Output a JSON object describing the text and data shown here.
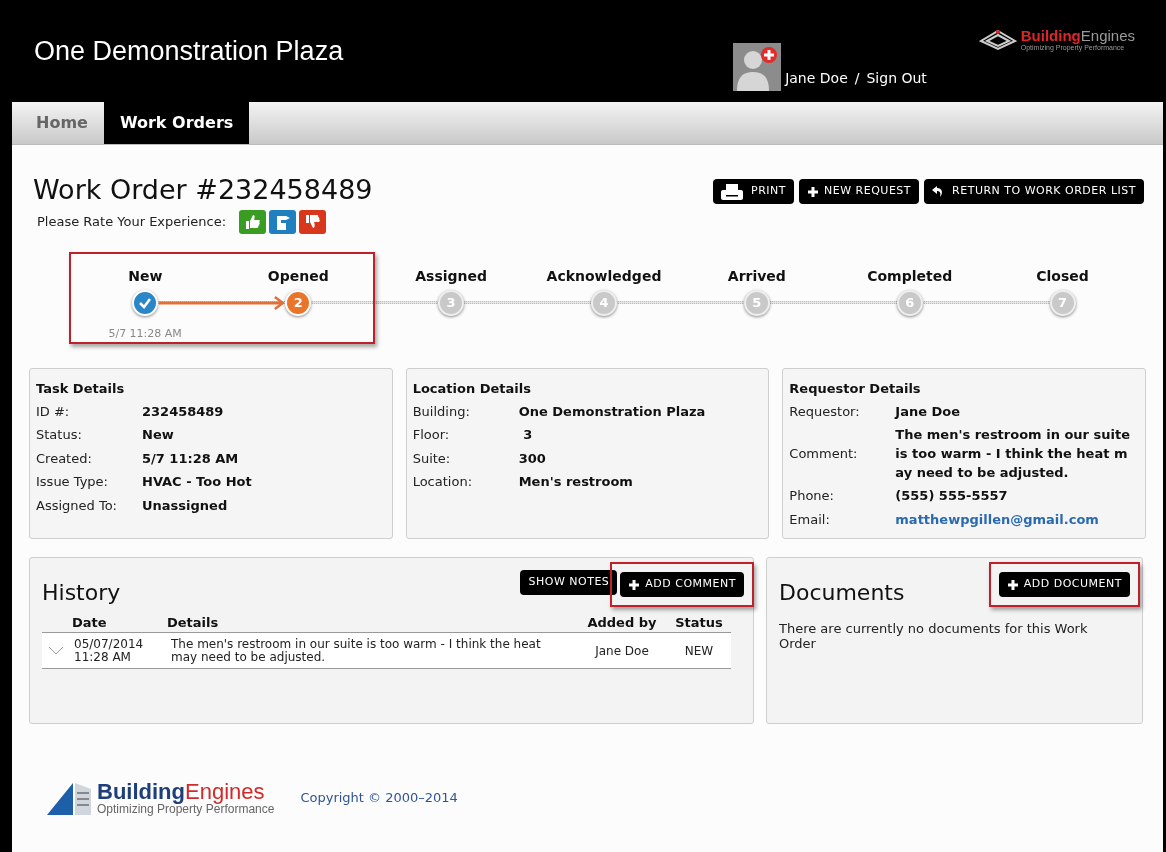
{
  "header": {
    "site_title": "One Demonstration Plaza",
    "user_name": "Jane Doe",
    "separator": "/",
    "sign_out": "Sign Out",
    "logo": {
      "strong": "Building",
      "light": "Engines",
      "tagline": "Optimizing Property Performance"
    }
  },
  "nav_tabs": [
    {
      "label": "Home",
      "selected": false
    },
    {
      "label": "Work Orders",
      "selected": true
    }
  ],
  "page_title": "Work Order #232458489",
  "toolbar_buttons": [
    {
      "label": "PRINT",
      "kind": "print"
    },
    {
      "label": "NEW REQUEST",
      "kind": "new"
    },
    {
      "label": "RETURN TO WORK ORDER LIST",
      "kind": "return"
    }
  ],
  "rating": {
    "label": "Please Rate Your Experience:",
    "options": [
      {
        "kind": "up",
        "color": "#3a9d23"
      },
      {
        "kind": "side",
        "color": "#1f7fbf"
      },
      {
        "kind": "down",
        "color": "#d9371c"
      }
    ]
  },
  "progress": {
    "steps": [
      {
        "label": "New",
        "kind": "done",
        "highlighted": true,
        "time": "5/7 11:28 AM"
      },
      {
        "label": "Opened",
        "kind": "current",
        "highlighted": true,
        "number": "2"
      },
      {
        "label": "Assigned",
        "kind": "pending",
        "highlighted": false,
        "number": "3"
      },
      {
        "label": "Acknowledged",
        "kind": "pending",
        "highlighted": false,
        "number": "4"
      },
      {
        "label": "Arrived",
        "kind": "pending",
        "highlighted": false,
        "number": "5"
      },
      {
        "label": "Completed",
        "kind": "pending",
        "highlighted": false,
        "number": "6"
      },
      {
        "label": "Closed",
        "kind": "pending",
        "highlighted": false,
        "number": "7"
      }
    ]
  },
  "detail_cards": [
    {
      "title": "Task Details",
      "rows": [
        {
          "label": "ID #:",
          "value": "232458489"
        },
        {
          "label": "Status:",
          "value": "New"
        },
        {
          "label": "Created:",
          "value": "5/7 11:28 AM"
        },
        {
          "label": "Issue Type:",
          "value": "HVAC - Too Hot"
        },
        {
          "label": "Assigned To:",
          "value": "Unassigned"
        }
      ]
    },
    {
      "title": "Location Details",
      "rows": [
        {
          "label": "Building:",
          "value": "One Demonstration Plaza"
        },
        {
          "label": "Floor:",
          "value": " 3"
        },
        {
          "label": "Suite:",
          "value": "300"
        },
        {
          "label": "Location:",
          "value": "Men's restroom"
        }
      ]
    },
    {
      "title": "Requestor Details",
      "rows": [
        {
          "label": "Requestor:",
          "value": "Jane Doe"
        },
        {
          "label": "Comment:",
          "lines": [
            "The men's restroom in our suite",
            "is too warm - I think the heat m",
            "ay need to be adjusted."
          ]
        },
        {
          "label": "Phone:",
          "value": "(555) 555-5557"
        },
        {
          "label": "Email:",
          "value": "matthewpgillen@gmail.com",
          "kind": "link"
        }
      ]
    }
  ],
  "history": {
    "title": "History",
    "buttons": [
      {
        "label": "SHOW NOTES",
        "kind": "notes",
        "highlighted": false
      },
      {
        "label": "ADD COMMENT",
        "kind": "add",
        "highlighted": true
      }
    ],
    "columns": [
      "Date",
      "Details",
      "Added by",
      "Status"
    ],
    "rows": [
      {
        "date": "05/07/2014",
        "time": "11:28 AM",
        "details": "The men's restroom in our suite is too warm - I think the heat may need to be adjusted.",
        "added_by": "Jane Doe",
        "status": "NEW",
        "expanded": false
      }
    ]
  },
  "documents": {
    "title": "Documents",
    "button": {
      "label": "ADD DOCUMENT",
      "kind": "add",
      "highlighted": true
    },
    "empty_message": "There are currently no documents for this Work Order"
  },
  "footer": {
    "logo": {
      "strong": "Building",
      "light": "Engines",
      "tagline": "Optimizing Property Performance"
    },
    "copyright": "Copyright © 2000–2014"
  }
}
